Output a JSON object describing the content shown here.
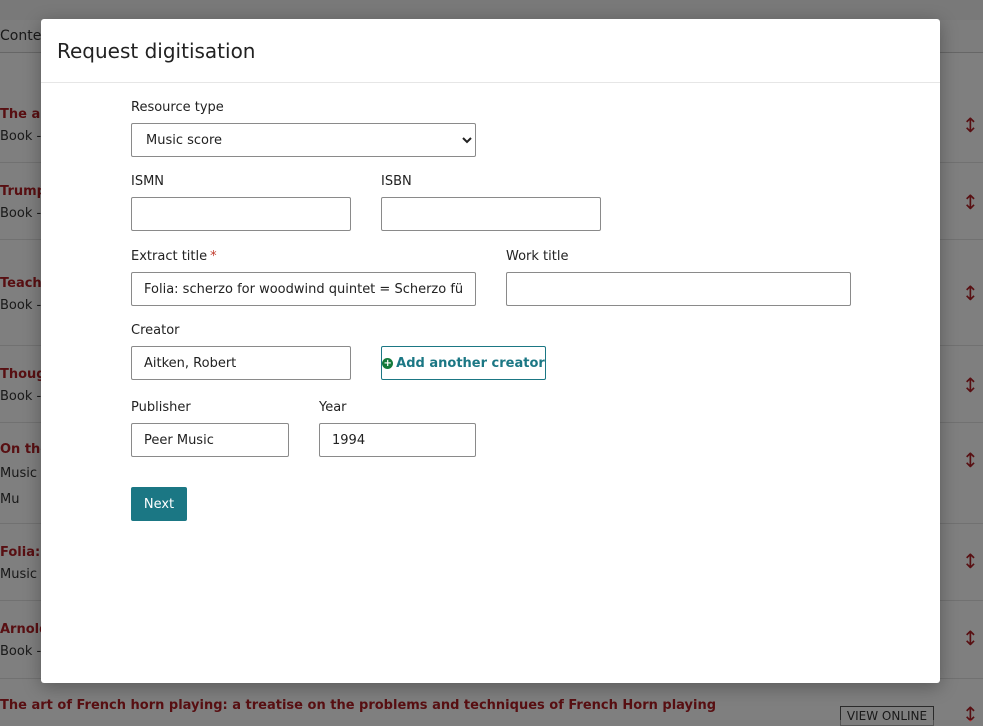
{
  "background": {
    "contents_label": "Contents",
    "rows": [
      {
        "title": "The art of",
        "sub": "Book  -"
      },
      {
        "title": "Trumpet",
        "sub": "Book  -"
      },
      {
        "title": "Teaching",
        "sub": "Book  -"
      },
      {
        "title": "Thought",
        "sub": "Book  -"
      },
      {
        "title": "On the dr",
        "sub": "Music Sc",
        "extra": "Mu"
      },
      {
        "title": "Folia: sc",
        "sub": "Music Sc"
      },
      {
        "title": "Arnold J",
        "sub": "Book  -"
      },
      {
        "title": "The art of French horn playing: a treatise on the problems and techniques of French Horn playing",
        "sub": ""
      }
    ],
    "view_online": "VIEW ONLINE"
  },
  "modal": {
    "title": "Request digitisation",
    "resource_type": {
      "label": "Resource type",
      "value": "Music score",
      "options": [
        "Music score"
      ]
    },
    "ismn": {
      "label": "ISMN",
      "value": ""
    },
    "isbn": {
      "label": "ISBN",
      "value": ""
    },
    "extract_title": {
      "label": "Extract title",
      "required_mark": "*",
      "value": "Folia: scherzo for woodwind quintet = Scherzo für Holzbläserquintett"
    },
    "work_title": {
      "label": "Work title",
      "value": ""
    },
    "creator": {
      "label": "Creator",
      "value": "Aitken, Robert"
    },
    "add_creator_label": "Add another creator",
    "publisher": {
      "label": "Publisher",
      "value": "Peer Music"
    },
    "year": {
      "label": "Year",
      "value": "1994"
    },
    "next_label": "Next"
  },
  "colors": {
    "accent": "#1b7784",
    "link_red": "#b01f24",
    "plus_green": "#137a3b"
  }
}
